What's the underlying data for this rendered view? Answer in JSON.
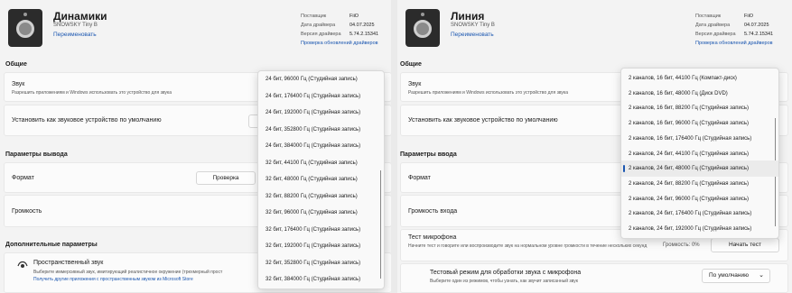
{
  "left": {
    "device": {
      "name": "Динамики",
      "model": "SNOWSKY Tiny B",
      "rename": "Переименовать",
      "info": [
        {
          "k": "Поставщик",
          "v": "FiiO"
        },
        {
          "k": "Дата драйвера",
          "v": "04.07.2025"
        },
        {
          "k": "Версия драйвера",
          "v": "5.74.2.15341"
        }
      ],
      "update_link": "Проверка обновлений драйверов"
    },
    "general": {
      "title": "Общие",
      "sound_title": "Звук",
      "sound_sub": "Разрешить приложениям и Windows использовать это устройство для звука",
      "default_title": "Установить как звуковое устройство по умолчанию",
      "default_btn_partial": "И"
    },
    "output": {
      "title": "Параметры вывода",
      "format_label": "Формат",
      "check_btn": "Проверка",
      "volume_label": "Громкость"
    },
    "extra": {
      "title": "Дополнительные параметры",
      "spatial_title": "Пространственный звук",
      "spatial_sub": "Выберите иммерсивный звук, имитирующий реалистичное окружение (трехмерный прост",
      "spatial_link": "Получить другие приложения с пространственным звуком из Microsoft Store"
    },
    "dropdown": [
      "24 бит, 96000 Гц (Студийная запись)",
      "24 бит, 176400 Гц (Студийная запись)",
      "24 бит, 192000 Гц (Студийная запись)",
      "24 бит, 352800 Гц (Студийная запись)",
      "24 бит, 384000 Гц (Студийная запись)",
      "32 бит, 44100 Гц (Студийная запись)",
      "32 бит, 48000 Гц (Студийная запись)",
      "32 бит, 88200 Гц (Студийная запись)",
      "32 бит, 96000 Гц (Студийная запись)",
      "32 бит, 176400 Гц (Студийная запись)",
      "32 бит, 192000 Гц (Студийная запись)",
      "32 бит, 352800 Гц (Студийная запись)",
      "32 бит, 384000 Гц (Студийная запись)"
    ]
  },
  "right": {
    "device": {
      "name": "Линия",
      "model": "SNOWSKY Tiny B",
      "rename": "Переименовать",
      "info": [
        {
          "k": "Поставщик",
          "v": "FiiO"
        },
        {
          "k": "Дата драйвера",
          "v": "04.07.2025"
        },
        {
          "k": "Версия драйвера",
          "v": "5.74.2.15341"
        }
      ],
      "update_link": "Проверка обновлений драйверов"
    },
    "general": {
      "title": "Общие",
      "sound_title": "Звук",
      "sound_sub": "Разрешить приложениям и Windows использовать это устройство для звука",
      "default_title": "Установить как звуковое устройство по умолчанию"
    },
    "input": {
      "title": "Параметры ввода",
      "format_label": "Формат",
      "volume_label": "Громкость входа",
      "mic_test_title": "Тест микрофона",
      "mic_test_sub": "Начните тест и говорите или воспроизводите звук на нормальном уровне громкости в течение нескольких секунд",
      "volume_pct": "Громкость: 0%",
      "start_test_btn": "Начать тест",
      "test_mode_title": "Тестовый режим для обработки звука с микрофона",
      "test_mode_sub": "Выберите один из режимов, чтобы узнать, как звучит записанный звук",
      "test_mode_value": "По умолчанию"
    },
    "dropdown_selected_index": 6,
    "dropdown": [
      "2 каналов, 16 бит, 44100 Гц (Компакт-диск)",
      "2 каналов, 16 бит, 48000 Гц (Диск DVD)",
      "2 каналов, 16 бит, 88200 Гц (Студийная запись)",
      "2 каналов, 16 бит, 96000 Гц (Студийная запись)",
      "2 каналов, 16 бит, 176400 Гц (Студийная запись)",
      "2 каналов, 24 бит, 44100 Гц (Студийная запись)",
      "2 каналов, 24 бит, 48000 Гц (Студийная запись)",
      "2 каналов, 24 бит, 88200 Гц (Студийная запись)",
      "2 каналов, 24 бит, 96000 Гц (Студийная запись)",
      "2 каналов, 24 бит, 176400 Гц (Студийная запись)",
      "2 каналов, 24 бит, 192000 Гц (Студийная запись)"
    ]
  }
}
